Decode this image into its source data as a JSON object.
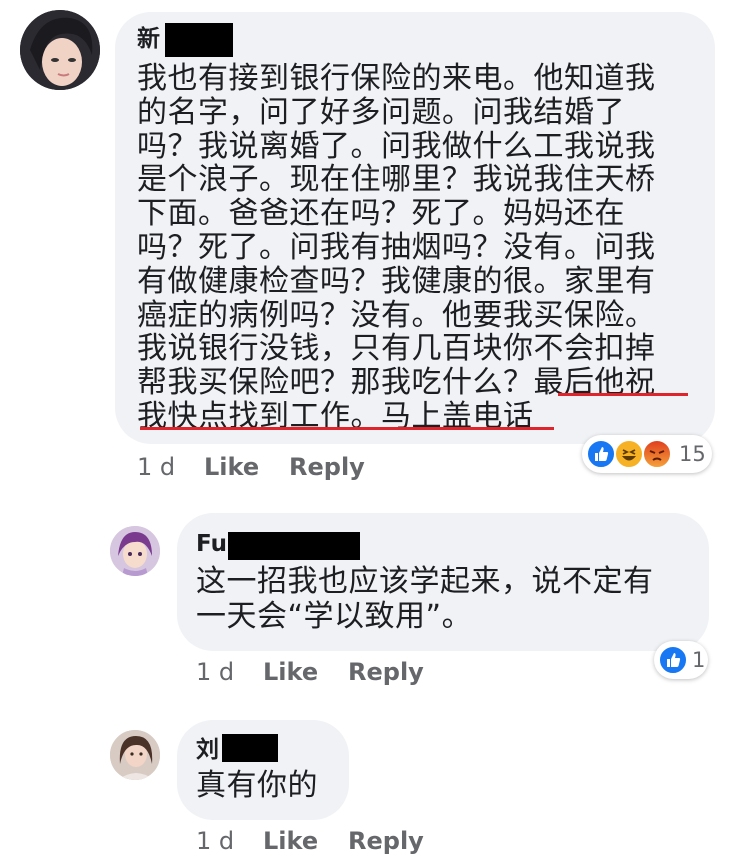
{
  "comment1": {
    "author_visible": "新",
    "lines": [
      "我也有接到银行保险的来电。他知道我",
      "的名字，问了好多问题。问我结婚了",
      "吗？我说离婚了。问我做什么工我说我",
      "是个浪子。现在住哪里？我说我住天桥",
      "下面。爸爸还在吗？死了。妈妈还在",
      "吗？死了。问我有抽烟吗？没有。问我",
      "有做健康检查吗？我健康的很。家里有",
      "癌症的病例吗？没有。他要我买保险。",
      "我说银行没钱，只有几百块你不会扣掉",
      "帮我买保险吧？那我吃什么？最后他祝",
      "我快点找到工作。马上盖电话"
    ],
    "time": "1 d",
    "like": "Like",
    "reply": "Reply",
    "reaction_count": "15",
    "reaction_icons": [
      "like-icon",
      "haha-icon",
      "angry-icon"
    ],
    "underline_color": "#e0242c"
  },
  "reply1": {
    "author_visible": "Fu",
    "lines": [
      "这一招我也应该学起来，说不定有",
      "一天会“学以致用”。"
    ],
    "time": "1 d",
    "like": "Like",
    "reply": "Reply",
    "reaction_count": "1",
    "reaction_icons": [
      "like-icon"
    ]
  },
  "reply2": {
    "author_visible": "刘",
    "lines": [
      "真有你的"
    ],
    "time": "1 d",
    "like": "Like",
    "reply": "Reply"
  },
  "colors": {
    "bubble": "#f0f2f5",
    "text": "#1c1e21",
    "meta": "#65676b",
    "like_blue": "#1877f2",
    "haha_yellow": "#f7b125",
    "angry_red": "#e9710f"
  }
}
